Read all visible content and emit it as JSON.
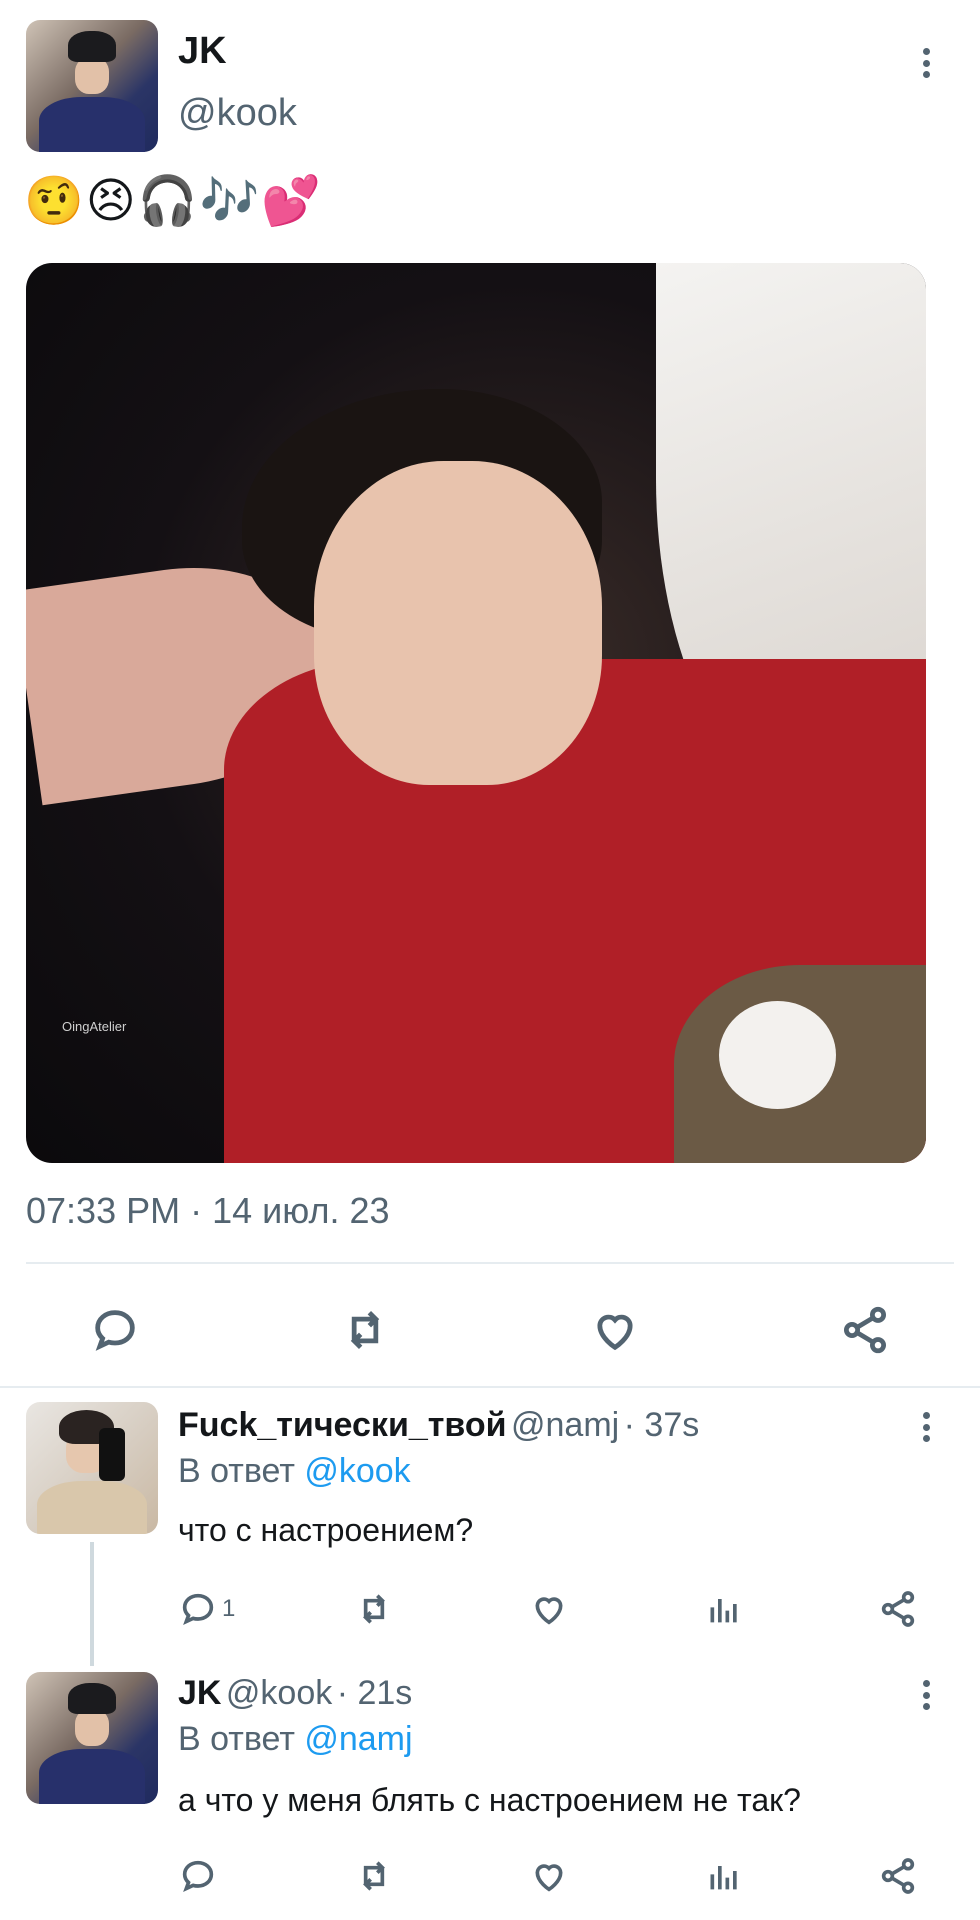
{
  "tweet": {
    "author_name": "JK",
    "author_handle": "@kook",
    "emoji_text": "🤨😣🎧🎶💕",
    "media_watermark": "OingAtelier",
    "timestamp": "07:33 PM · 14 июл. 23"
  },
  "replies": [
    {
      "name": "Fuck_тически_твой",
      "handle": "@namj",
      "time": "· 37s",
      "reply_to_prefix": "В ответ ",
      "reply_to_handle": "@kook",
      "text": "что с настроением?",
      "reply_count": "1"
    },
    {
      "name": "JK",
      "handle": "@kook",
      "time": "· 21s",
      "reply_to_prefix": "В ответ ",
      "reply_to_handle": "@namj",
      "text": "а что у меня блять с настроением не так?",
      "reply_count": ""
    }
  ],
  "colors": {
    "accent": "#1d9bf0",
    "secondary_text": "#536471",
    "divider": "#e6ecf0"
  },
  "icons": [
    "reply-icon",
    "retweet-icon",
    "like-icon",
    "share-icon",
    "views-icon",
    "more-icon"
  ]
}
